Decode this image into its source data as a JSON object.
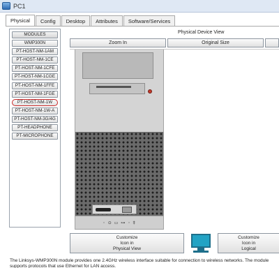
{
  "window": {
    "title": "PC1"
  },
  "tabs": [
    {
      "label": "Physical"
    },
    {
      "label": "Config"
    },
    {
      "label": "Desktop"
    },
    {
      "label": "Attributes"
    },
    {
      "label": "Software/Services"
    }
  ],
  "modules": {
    "header": "MODULES",
    "items": [
      {
        "label": "WMP300N"
      },
      {
        "label": "PT-HOST-NM-1AM"
      },
      {
        "label": "PT-HOST-NM-1CE"
      },
      {
        "label": "PT-HOST-NM-1CFE"
      },
      {
        "label": "PT-HOST-NM-1CGE"
      },
      {
        "label": "PT-HOST-NM-1FFE"
      },
      {
        "label": "PT-HOST-NM-1FGE"
      },
      {
        "label": "PT-HOST-NM-1W"
      },
      {
        "label": "PT-HOST-NM-1W-A"
      },
      {
        "label": "PT-HOST-NM-3G/4G"
      },
      {
        "label": "PT-HEADPHONE"
      },
      {
        "label": "PT-MICROPHONE"
      }
    ]
  },
  "physical_view": {
    "title": "Physical Device View",
    "zoom_in": "Zoom In",
    "original_size": "Original Size"
  },
  "customize": {
    "physical": "Customize\nIcon in\nPhysical View",
    "logical": "Customize\nIcon in\nLogical"
  },
  "description": "The Linksys-WMP300N module provides one 2.4GHz wireless interface suitable for connection to wireless networks. The module supports protocols that use Ethernet for LAN access."
}
